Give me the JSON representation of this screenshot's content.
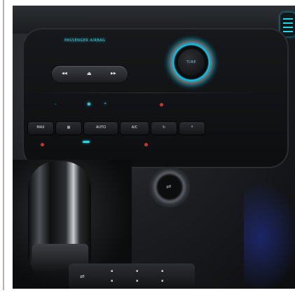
{
  "image": {
    "subject": "car-center-console",
    "accent_color": "#1ec3e0",
    "labels": {
      "audio_label": "PASSENGER AIRBAG",
      "knob_label": "TUNE",
      "auto_label": "AUTO",
      "ac_label": "A/C",
      "max_label": "MAX"
    },
    "icons": [
      "usb-icon",
      "fan-icon",
      "defrost-icon",
      "heated-seat-icon",
      "seek-back-icon",
      "eject-icon",
      "seek-forward-icon",
      "vent-icon"
    ]
  }
}
